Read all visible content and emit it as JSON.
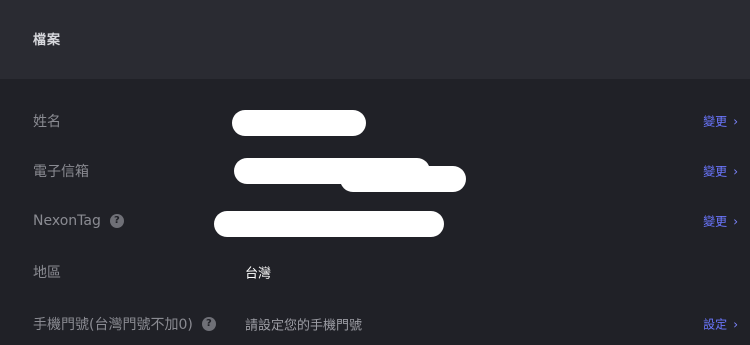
{
  "header": {
    "title": "檔案"
  },
  "rows": [
    {
      "label": "姓名",
      "value": "",
      "action": "變更"
    },
    {
      "label": "電子信箱",
      "value": "",
      "action": "變更"
    },
    {
      "label": "NexonTag",
      "help": "?",
      "value": "",
      "action": "變更"
    },
    {
      "label": "地區",
      "value": "台灣",
      "action": ""
    },
    {
      "label": "手機門號(台灣門號不加0)",
      "help": "?",
      "value": "請設定您的手機門號",
      "action": "設定"
    }
  ],
  "icons": {
    "help": "help-circle-icon",
    "chevron": "chevron-right-icon"
  },
  "colors": {
    "accent": "#6b77ff",
    "background": "#202127",
    "header": "#2a2b32"
  }
}
